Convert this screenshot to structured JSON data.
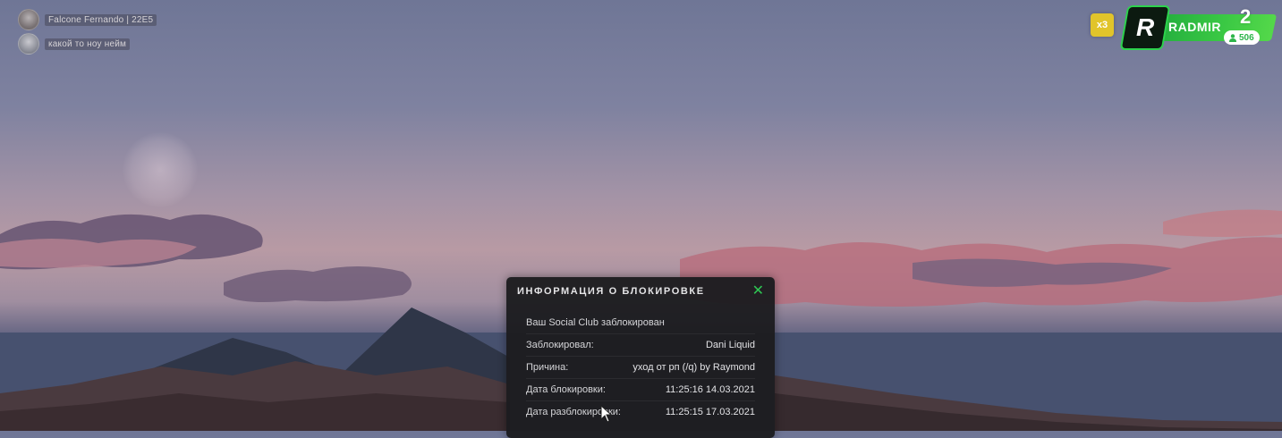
{
  "players": [
    {
      "name": "Falcone Fernando | 22E5"
    },
    {
      "name": "какой то ноу нейм"
    }
  ],
  "hud": {
    "multiplier": "x3",
    "server_logo": "R",
    "server_name": "RADMIR",
    "server_number": "2",
    "online_count": "506",
    "accent": "#2fc653"
  },
  "modal": {
    "title": "ИНФОРМАЦИЯ О БЛОКИРОВКЕ",
    "close_symbol": "✕",
    "message": "Ваш Social Club заблокирован",
    "rows": [
      {
        "label": "Заблокировал:",
        "value": "Dani Liquid"
      },
      {
        "label": "Причина:",
        "value": "уход от рп (/q) by Raymond"
      },
      {
        "label": "Дата блокировки:",
        "value": "11:25:16 14.03.2021"
      },
      {
        "label": "Дата разблокировки:",
        "value": "11:25:15 17.03.2021"
      }
    ]
  }
}
